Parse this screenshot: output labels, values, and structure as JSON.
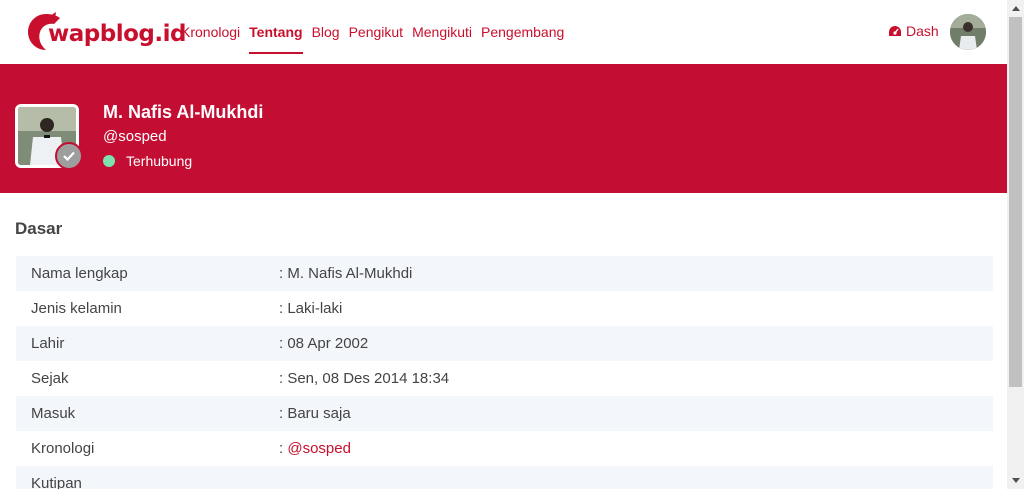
{
  "brand": {
    "logo_text": "wapblog.id",
    "color": "#c8102e"
  },
  "nav": {
    "items": [
      {
        "label": "Kronologi",
        "active": false
      },
      {
        "label": "Tentang",
        "active": true
      },
      {
        "label": "Blog",
        "active": false
      },
      {
        "label": "Pengikut",
        "active": false
      },
      {
        "label": "Mengikuti",
        "active": false
      },
      {
        "label": "Pengembang",
        "active": false
      }
    ],
    "dash_label": "Dash"
  },
  "profile": {
    "name": "M. Nafis Al-Mukhdi",
    "handle": "@sosped",
    "status": "Terhubung",
    "banner_color": "#c40d33"
  },
  "section": {
    "title": "Dasar",
    "rows": [
      {
        "label": "Nama lengkap",
        "value": ": M. Nafis Al-Mukhdi"
      },
      {
        "label": "Jenis kelamin",
        "value": ": Laki-laki"
      },
      {
        "label": "Lahir",
        "value": ": 08 Apr 2002"
      },
      {
        "label": "Sejak",
        "value": ": Sen, 08 Des 2014 18:34"
      },
      {
        "label": "Masuk",
        "value": ": Baru saja"
      },
      {
        "label": "Kronologi",
        "value_prefix": ": ",
        "value_link": "@sosped"
      },
      {
        "label": "Kutipan",
        "value": ""
      }
    ]
  }
}
